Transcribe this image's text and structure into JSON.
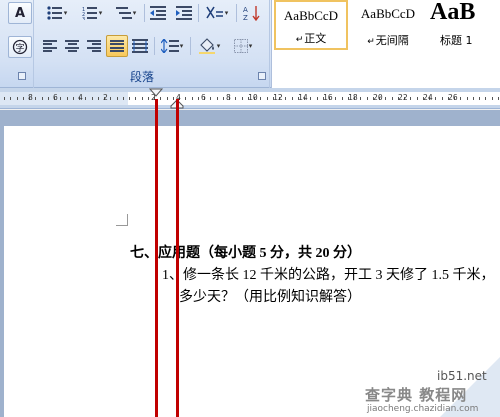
{
  "ribbon": {
    "paragraph_group_label": "段落",
    "styles": [
      {
        "sample": "AaBbCcD",
        "name": "正文",
        "marker": "↵"
      },
      {
        "sample": "AaBbCcD",
        "name": "无间隔",
        "marker": "↵"
      },
      {
        "sample": "AaB",
        "name": "标题 1",
        "marker": ""
      }
    ]
  },
  "ruler": {
    "left_numbers": [
      "8",
      "6",
      "4",
      "2"
    ],
    "right_numbers": [
      "2",
      "4",
      "6",
      "8",
      "10",
      "12",
      "14",
      "16",
      "18",
      "20",
      "22",
      "24",
      "26"
    ]
  },
  "document": {
    "heading": "七、应用题（每小题 5 分，共 20 分）",
    "line1": "1、修一条长 12 千米的公路，开工 3 天修了 1.5 千米，",
    "line2": "多少天？（用比例知识解答）"
  },
  "watermark": {
    "site_short": "ib51.net",
    "cn_text": "查字典 教程网",
    "url": "jiaocheng.chazidian.com"
  },
  "colors": {
    "ribbon_bg": "#d4e1f4",
    "selected_style_border": "#f0c360",
    "red_guide": "#c00000",
    "doc_background": "#9fb2cd"
  }
}
